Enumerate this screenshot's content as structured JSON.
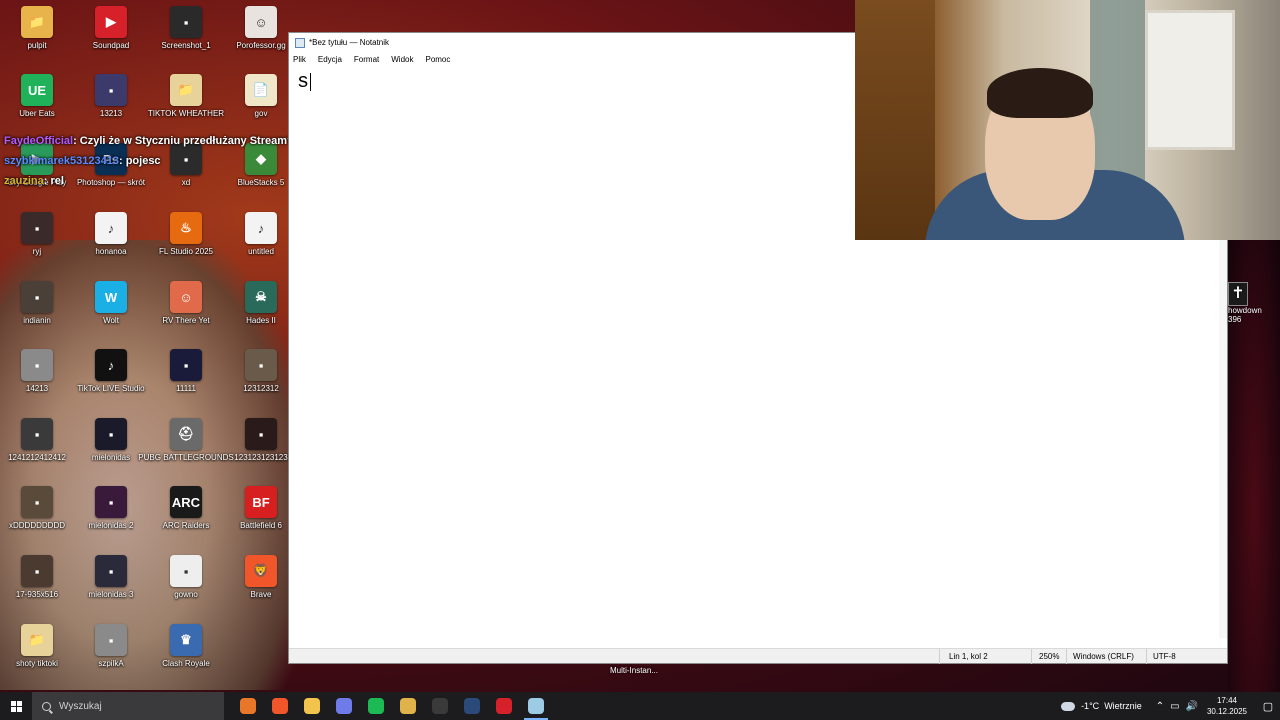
{
  "desktop": {
    "icons": [
      {
        "label": "pulpit",
        "color": "#e7b34a",
        "glyph": "📁"
      },
      {
        "label": "Soundpad",
        "color": "#d6202a",
        "glyph": "▶"
      },
      {
        "label": "Screenshot_1",
        "color": "#2a2a2a",
        "glyph": "▪"
      },
      {
        "label": "Porofessor.gg",
        "color": "#e9e3e0",
        "glyph": "☺"
      },
      {
        "label": "Uber Eats",
        "color": "#20b25a",
        "glyph": "UE"
      },
      {
        "label": "13213",
        "color": "#3b3a6a",
        "glyph": "▪"
      },
      {
        "label": "TIKTOK WHEATHER",
        "color": "#e7d29a",
        "glyph": "📁"
      },
      {
        "label": "gov",
        "color": "#f0e6c8",
        "glyph": "📄"
      },
      {
        "label": "Gry Google Play",
        "color": "#2a9a5a",
        "glyph": "▶"
      },
      {
        "label": "Photoshop — skrót",
        "color": "#0a2f55",
        "glyph": "Ps"
      },
      {
        "label": "xd",
        "color": "#2b2b2b",
        "glyph": "▪"
      },
      {
        "label": "BlueStacks 5",
        "color": "#3a8a3a",
        "glyph": "◆"
      },
      {
        "label": "ryj",
        "color": "#3a2a2a",
        "glyph": "▪"
      },
      {
        "label": "honanoa",
        "color": "#f3f3f3",
        "glyph": "♪"
      },
      {
        "label": "FL Studio 2025",
        "color": "#e66a10",
        "glyph": "♨"
      },
      {
        "label": "untitled",
        "color": "#f3f3f3",
        "glyph": "♪"
      },
      {
        "label": "indianin",
        "color": "#4a4038",
        "glyph": "▪"
      },
      {
        "label": "Wolt",
        "color": "#1ab0e6",
        "glyph": "W"
      },
      {
        "label": "RV There Yet",
        "color": "#e06a4a",
        "glyph": "☺"
      },
      {
        "label": "Hades II",
        "color": "#2a6a5a",
        "glyph": "☠"
      },
      {
        "label": "14213",
        "color": "#8a8a8a",
        "glyph": "▪"
      },
      {
        "label": "TikTok LIVE Studio",
        "color": "#111111",
        "glyph": "♪"
      },
      {
        "label": "11111",
        "color": "#1a1a3a",
        "glyph": "▪"
      },
      {
        "label": "12312312",
        "color": "#6a5a4a",
        "glyph": "▪"
      },
      {
        "label": "1241212412412",
        "color": "#3a3a3a",
        "glyph": "▪"
      },
      {
        "label": "mielonidas",
        "color": "#1a1a2a",
        "glyph": "▪"
      },
      {
        "label": "PUBG BATTLEGROUNDS",
        "color": "#6a6a6a",
        "glyph": "⛑"
      },
      {
        "label": "123123123123",
        "color": "#2a1a1a",
        "glyph": "▪"
      },
      {
        "label": "xDDDDDDDDD",
        "color": "#5a4a3a",
        "glyph": "▪"
      },
      {
        "label": "mielonidas 2",
        "color": "#3a1a3a",
        "glyph": "▪"
      },
      {
        "label": "ARC Raiders",
        "color": "#1a1a1a",
        "glyph": "ARC"
      },
      {
        "label": "Battlefield 6",
        "color": "#d81f1f",
        "glyph": "BF"
      },
      {
        "label": "17-935x516",
        "color": "#4a3a30",
        "glyph": "▪"
      },
      {
        "label": "mielonidas 3",
        "color": "#2a2a3a",
        "glyph": "▪"
      },
      {
        "label": "gowno",
        "color": "#eeeeee",
        "glyph": "▪"
      },
      {
        "label": "Brave",
        "color": "#f1562b",
        "glyph": "🦁"
      },
      {
        "label": "shoty tiktoki",
        "color": "#e7d29a",
        "glyph": "📁"
      },
      {
        "label": "szpilkA",
        "color": "#8a8a8a",
        "glyph": "▪"
      },
      {
        "label": "Clash Royale",
        "color": "#3a6ab0",
        "glyph": "♛"
      }
    ],
    "right_partial_icon": {
      "label1": "howdown",
      "label2": "396"
    }
  },
  "chat": [
    {
      "user": "FaydeOfficial",
      "text": ": Czyli że w Styczniu przedłużany Stream?"
    },
    {
      "user": "szybkimarek53123413",
      "text": ": pojesc"
    },
    {
      "user": "zauzina",
      "text": ": rel"
    }
  ],
  "notepad": {
    "title": "*Bez tytułu — Notatnik",
    "menu": [
      "Plik",
      "Edycja",
      "Format",
      "Widok",
      "Pomoc"
    ],
    "content": "s",
    "status": {
      "position": "Lin 1, kol 2",
      "zoom": "250%",
      "line_ending": "Windows (CRLF)",
      "encoding": "UTF-8"
    }
  },
  "multi_instance_label": "Multi-Instan...",
  "taskbar": {
    "search_placeholder": "Wyszukaj",
    "apps": [
      {
        "name": "firefox-icon",
        "color": "#e8772a"
      },
      {
        "name": "brave-icon",
        "color": "#f1562b"
      },
      {
        "name": "file-explorer-icon",
        "color": "#f2c44d"
      },
      {
        "name": "discord-icon",
        "color": "#6e7be8"
      },
      {
        "name": "spotify-icon",
        "color": "#1db954"
      },
      {
        "name": "app-yellow-icon",
        "color": "#e0b34a"
      },
      {
        "name": "obs-icon",
        "color": "#3a3a3a"
      },
      {
        "name": "steam-icon",
        "color": "#2a4a7a"
      },
      {
        "name": "youtube-icon",
        "color": "#d6202a"
      },
      {
        "name": "notepad-icon",
        "color": "#9ccbe6"
      }
    ],
    "weather": {
      "temp": "-1°C",
      "desc": "Wietrznie"
    },
    "clock": {
      "time": "17:44",
      "date": "30.12.2025"
    }
  }
}
